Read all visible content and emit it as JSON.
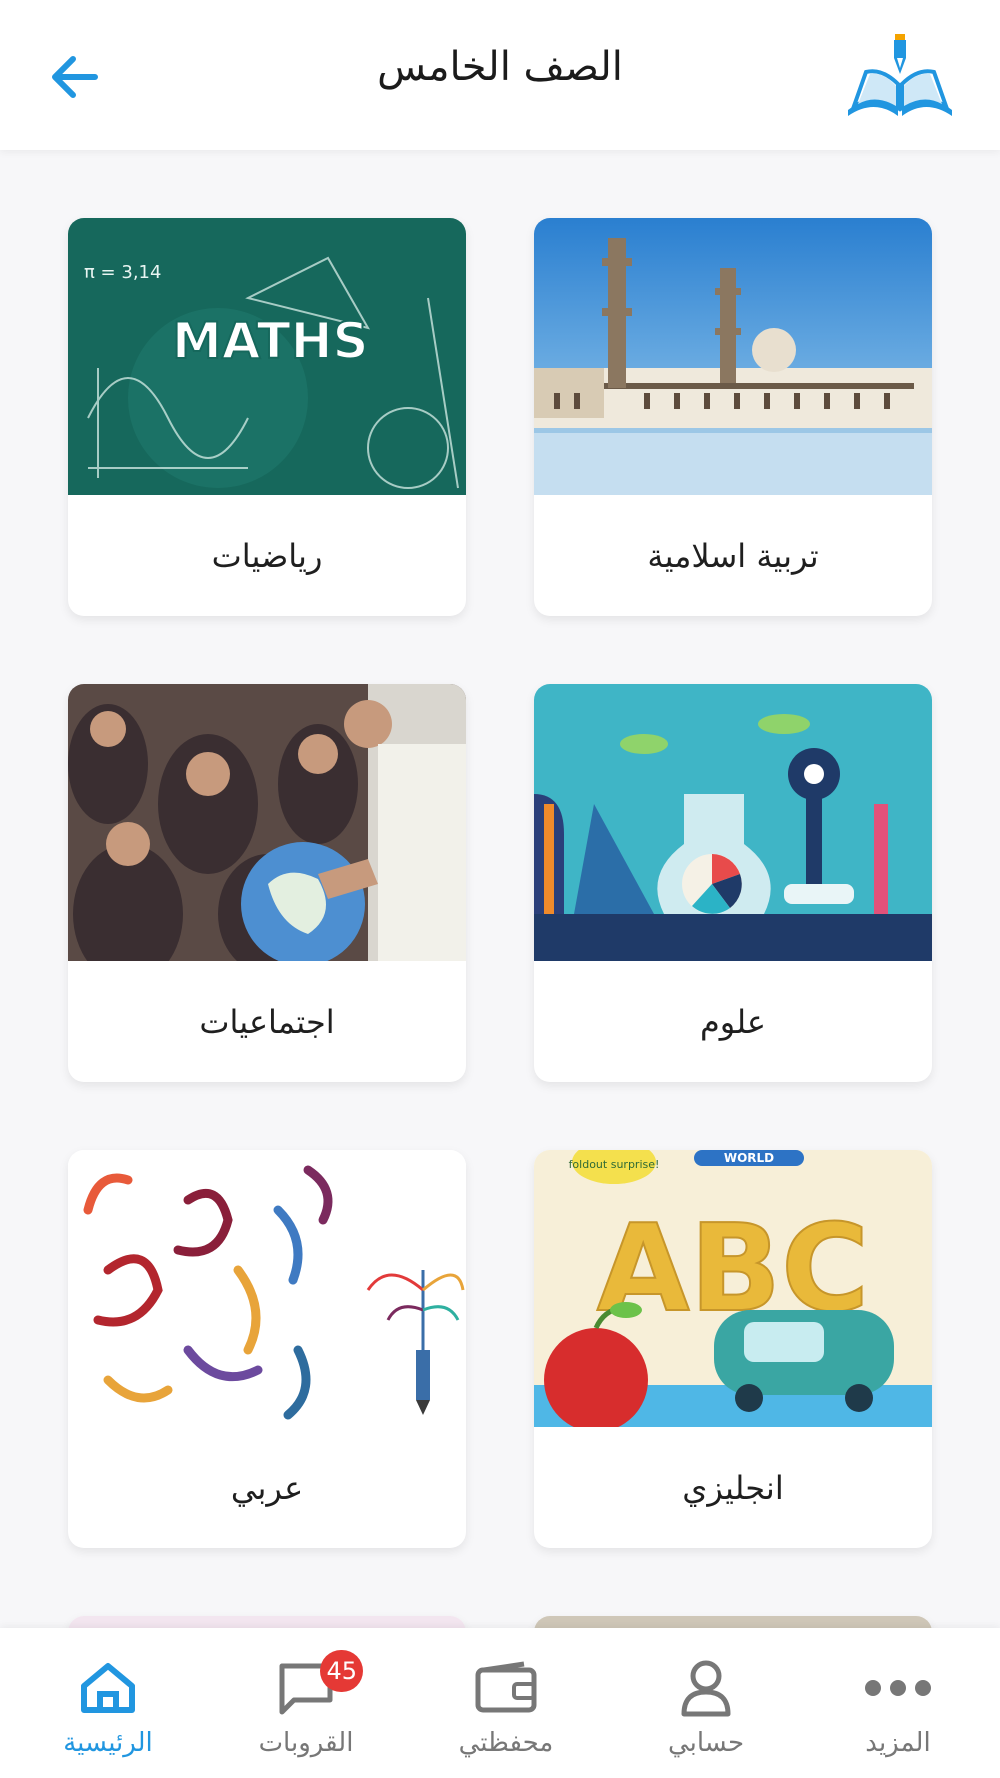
{
  "header": {
    "title": "الصف الخامس",
    "back_icon": "arrow-left-icon",
    "logo_icon": "open-book-pen-logo"
  },
  "subjects": [
    {
      "label": "تربية اسلامية",
      "image": "mosque-courtyard"
    },
    {
      "label": "رياضيات",
      "image": "maths-chalkboard"
    },
    {
      "label": "علوم",
      "image": "science-illustration"
    },
    {
      "label": "اجتماعيات",
      "image": "students-with-globe"
    },
    {
      "label": "انجليزي",
      "image": "abc-book-cover"
    },
    {
      "label": "عربي",
      "image": "arabic-letters-art"
    }
  ],
  "thumb_texts": {
    "maths": "MATHS",
    "maths_pi": "π = 3,14",
    "abc": "ABC",
    "abc_banner": "foldout surprise!",
    "abc_world": "WORLD"
  },
  "nav": {
    "items": [
      {
        "label": "الرئيسية",
        "icon": "home-icon",
        "active": true
      },
      {
        "label": "القروبات",
        "icon": "chat-icon",
        "badge": "45"
      },
      {
        "label": "محفظتي",
        "icon": "wallet-icon"
      },
      {
        "label": "حسابي",
        "icon": "user-icon"
      },
      {
        "label": "المزيد",
        "icon": "more-icon"
      }
    ]
  },
  "colors": {
    "accent": "#2196e0",
    "badge": "#e53935",
    "text": "#1f1f1f"
  }
}
